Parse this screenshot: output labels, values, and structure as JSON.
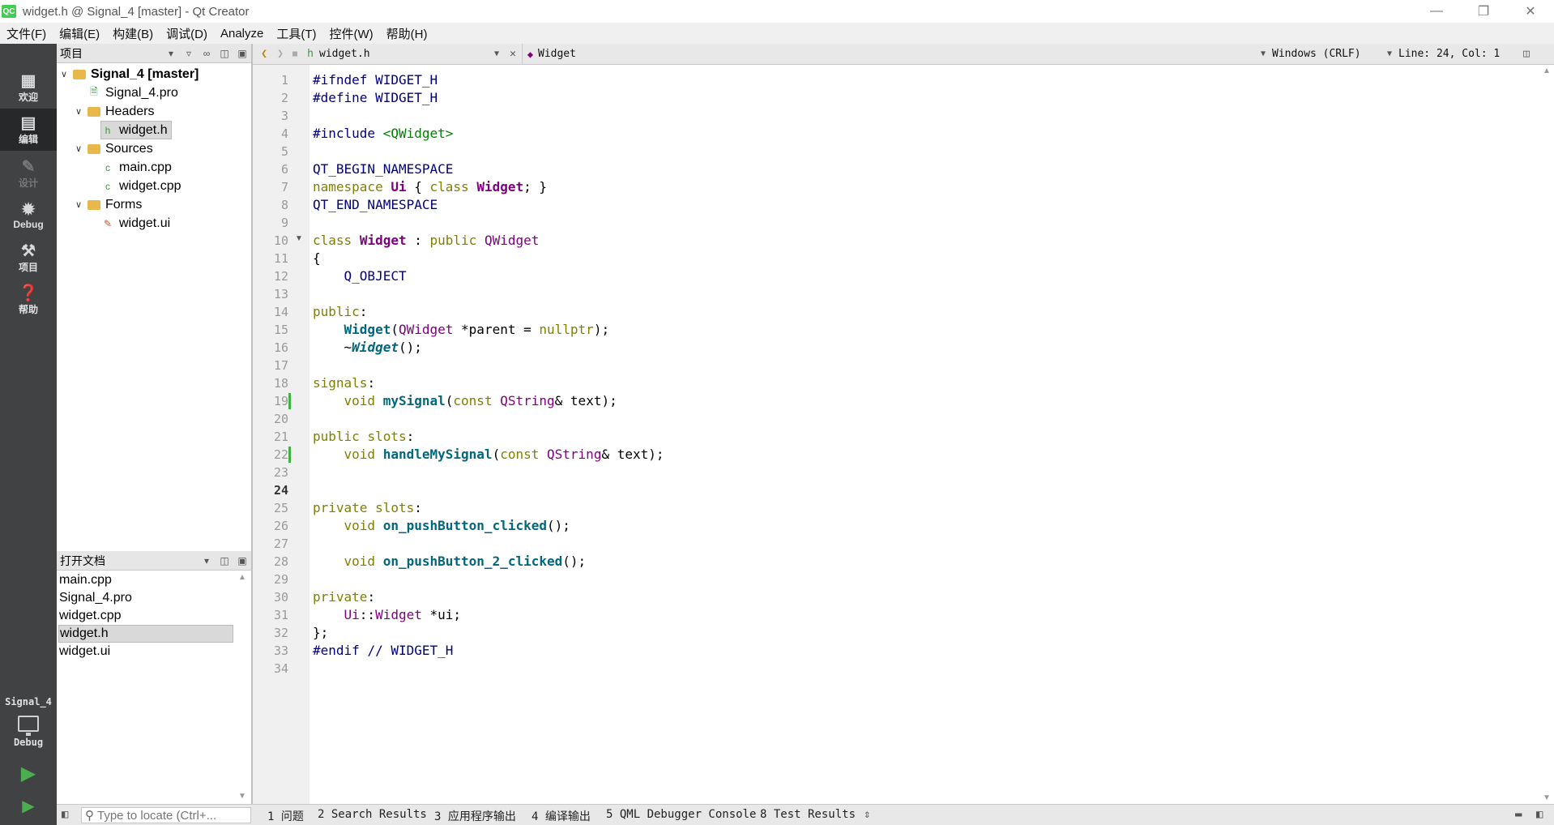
{
  "window": {
    "title": "widget.h @ Signal_4 [master] - Qt Creator",
    "icon_label": "QC"
  },
  "menu": [
    "文件(F)",
    "编辑(E)",
    "构建(B)",
    "调试(D)",
    "Analyze",
    "工具(T)",
    "控件(W)",
    "帮助(H)"
  ],
  "modes": [
    {
      "label": "欢迎",
      "icon": "grid-icon"
    },
    {
      "label": "编辑",
      "icon": "edit-doc-icon"
    },
    {
      "label": "设计",
      "icon": "pencil-icon"
    },
    {
      "label": "Debug",
      "icon": "bug-icon"
    },
    {
      "label": "项目",
      "icon": "wrench-icon"
    },
    {
      "label": "帮助",
      "icon": "help-icon"
    }
  ],
  "kit": {
    "name": "Signal_4",
    "config": "Debug"
  },
  "project_pane": {
    "title": "项目"
  },
  "tree": [
    {
      "label": "Signal_4 [master]",
      "level": 0,
      "bold": true
    },
    {
      "label": "Signal_4.pro",
      "level": 1
    },
    {
      "label": "Headers",
      "level": 1
    },
    {
      "label": "widget.h",
      "level": 2
    },
    {
      "label": "Sources",
      "level": 1
    },
    {
      "label": "main.cpp",
      "level": 2
    },
    {
      "label": "widget.cpp",
      "level": 2
    },
    {
      "label": "Forms",
      "level": 1
    },
    {
      "label": "widget.ui",
      "level": 2
    }
  ],
  "open_docs": {
    "title": "打开文档",
    "items": [
      "main.cpp",
      "Signal_4.pro",
      "widget.cpp",
      "widget.h",
      "widget.ui"
    ],
    "selected": "widget.h"
  },
  "editor_toolbar": {
    "file": "widget.h",
    "symbol": "Widget",
    "line_ending": "Windows (CRLF)",
    "position": "Line: 24, Col: 1"
  },
  "code": {
    "current_line": 24,
    "changed_lines": [
      19,
      22
    ],
    "fold_line": 10,
    "lines": [
      "#ifndef WIDGET_H",
      "#define WIDGET_H",
      "",
      "#include <QWidget>",
      "",
      "QT_BEGIN_NAMESPACE",
      "namespace Ui { class Widget; }",
      "QT_END_NAMESPACE",
      "",
      "class Widget : public QWidget",
      "{",
      "    Q_OBJECT",
      "",
      "public:",
      "    Widget(QWidget *parent = nullptr);",
      "    ~Widget();",
      "",
      "signals:",
      "    void mySignal(const QString& text);",
      "",
      "public slots:",
      "    void handleMySignal(const QString& text);",
      "",
      "",
      "private slots:",
      "    void on_pushButton_clicked();",
      "",
      "    void on_pushButton_2_clicked();",
      "",
      "private:",
      "    Ui::Widget *ui;",
      "};",
      "#endif // WIDGET_H",
      ""
    ]
  },
  "status": {
    "locator_placeholder": "Type to locate (Ctrl+...",
    "tabs": [
      "1 问题",
      "2 Search Results",
      "3 应用程序输出",
      "4 编译输出",
      "5 QML Debugger Console",
      "8 Test Results"
    ]
  }
}
